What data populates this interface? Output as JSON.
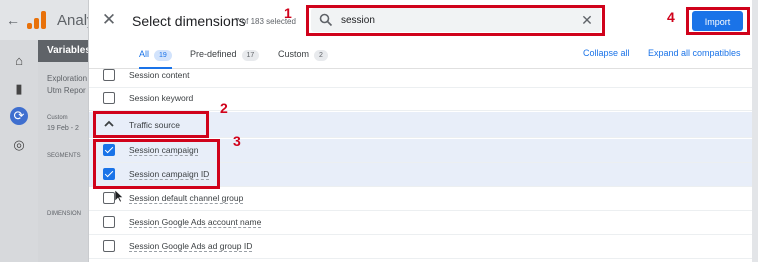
{
  "underlay": {
    "app_name": "Analy",
    "panel_header": "Variables",
    "exploration_label": "Exploration",
    "exploration_name": "Utm Repor",
    "custom_label": "Custom",
    "date_range": "19 Feb - 2",
    "segments_label": "SEGMENTS",
    "dimensions_label": "DIMENSION"
  },
  "dialog": {
    "title": "Select dimensions",
    "selected_count": "7 of 183 selected",
    "search": {
      "value": "session",
      "placeholder": ""
    },
    "import_label": "Import",
    "tabs": [
      {
        "label": "All",
        "count": "19",
        "active": true
      },
      {
        "label": "Pre-defined",
        "count": "17",
        "active": false
      },
      {
        "label": "Custom",
        "count": "2",
        "active": false
      }
    ],
    "collapse_all": "Collapse all",
    "expand_all": "Expand all compatibles",
    "rows": [
      {
        "label": "Session content",
        "checked": false
      },
      {
        "label": "Session keyword",
        "checked": false
      },
      {
        "label": "Traffic source",
        "group": true
      },
      {
        "label": "Session campaign",
        "checked": true
      },
      {
        "label": "Session campaign ID",
        "checked": true
      },
      {
        "label": "Session default channel group",
        "checked": false
      },
      {
        "label": "Session Google Ads account name",
        "checked": false
      },
      {
        "label": "Session Google Ads ad group ID",
        "checked": false
      }
    ]
  },
  "annotations": [
    "1",
    "2",
    "3",
    "4"
  ],
  "colors": {
    "accent": "#1a73e8",
    "annotation": "#d0021b",
    "selected_row": "#e8eef9"
  }
}
